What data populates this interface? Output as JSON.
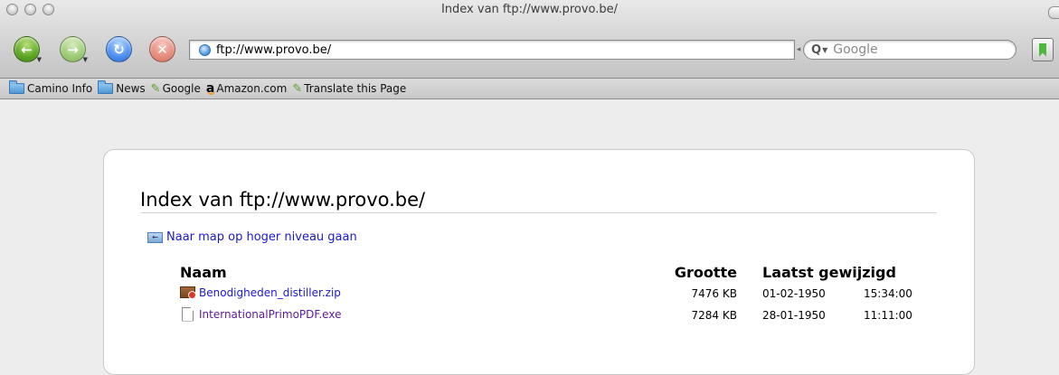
{
  "window": {
    "title": "Index van ftp://www.provo.be/"
  },
  "toolbar": {
    "back_icon": "back-arrow-icon",
    "forward_icon": "forward-arrow-icon",
    "reload_icon": "reload-icon",
    "stop_icon": "stop-x-icon",
    "url": "ftp://www.provo.be/",
    "search_placeholder": "Google",
    "accent_back": "#5ca623",
    "accent_reload": "#4c8ff0",
    "accent_stop": "#e58c7e"
  },
  "bookmarks": [
    {
      "label": "Camino Info",
      "icon": "folder-icon"
    },
    {
      "label": "News",
      "icon": "folder-icon"
    },
    {
      "label": "Google",
      "icon": "pencil-icon"
    },
    {
      "label": "Amazon.com",
      "icon": "amazon-icon"
    },
    {
      "label": "Translate this Page",
      "icon": "pencil-icon"
    }
  ],
  "listing": {
    "heading": "Index van ftp://www.provo.be/",
    "parent_link": "Naar map op hoger niveau gaan",
    "columns": {
      "name": "Naam",
      "size": "Grootte",
      "modified": "Laatst gewijzigd"
    },
    "files": [
      {
        "name": "Benodigheden_distiller.zip",
        "size": "7476 KB",
        "date": "01-02-1950",
        "time": "15:34:00",
        "icon": "zip-archive-icon"
      },
      {
        "name": "InternationalPrimoPDF.exe",
        "size": "7284 KB",
        "date": "28-01-1950",
        "time": "11:11:00",
        "icon": "document-icon"
      }
    ]
  }
}
